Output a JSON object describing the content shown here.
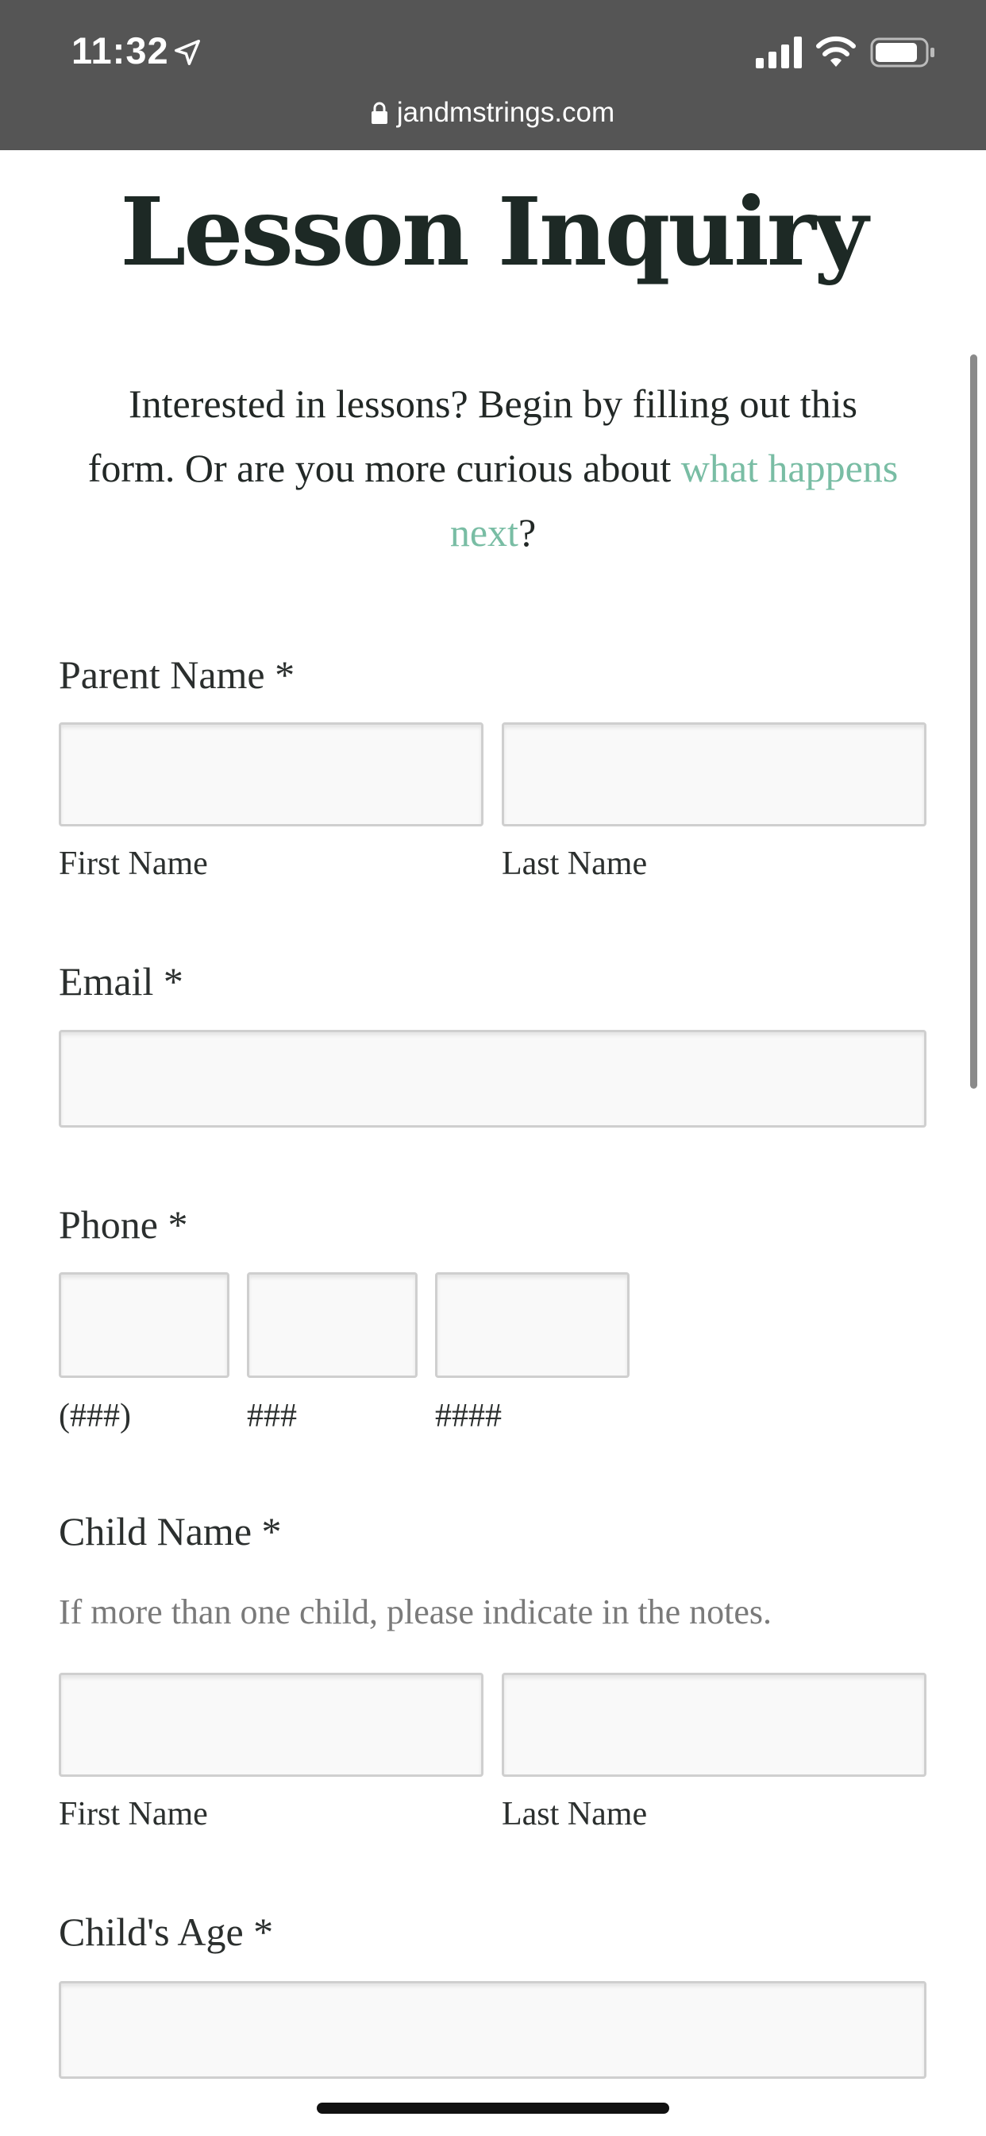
{
  "status_bar": {
    "time": "11:32",
    "icons": [
      "location-arrow-icon",
      "cellular-signal-icon",
      "wifi-icon",
      "battery-icon"
    ]
  },
  "browser": {
    "url": "jandmstrings.com"
  },
  "page": {
    "title": "Lesson Inquiry",
    "intro_text": "Interested in lessons? Begin by filling out this form. Or are you more curious about ",
    "intro_link": "what happens next",
    "intro_end": "?",
    "link_color": "#79bda4"
  },
  "form": {
    "parent_name": {
      "label": "Parent Name *",
      "first_label": "First Name",
      "last_label": "Last Name",
      "first_value": "",
      "last_value": ""
    },
    "email": {
      "label": "Email *",
      "value": ""
    },
    "phone": {
      "label": "Phone *",
      "area_label": "(###)",
      "prefix_label": "###",
      "line_label": "####",
      "area_value": "",
      "prefix_value": "",
      "line_value": ""
    },
    "child_name": {
      "label": "Child Name *",
      "help": "If more than one child, please indicate in the notes.",
      "first_label": "First Name",
      "last_label": "Last Name",
      "first_value": "",
      "last_value": ""
    },
    "child_age": {
      "label": "Child's Age *",
      "value": ""
    }
  }
}
